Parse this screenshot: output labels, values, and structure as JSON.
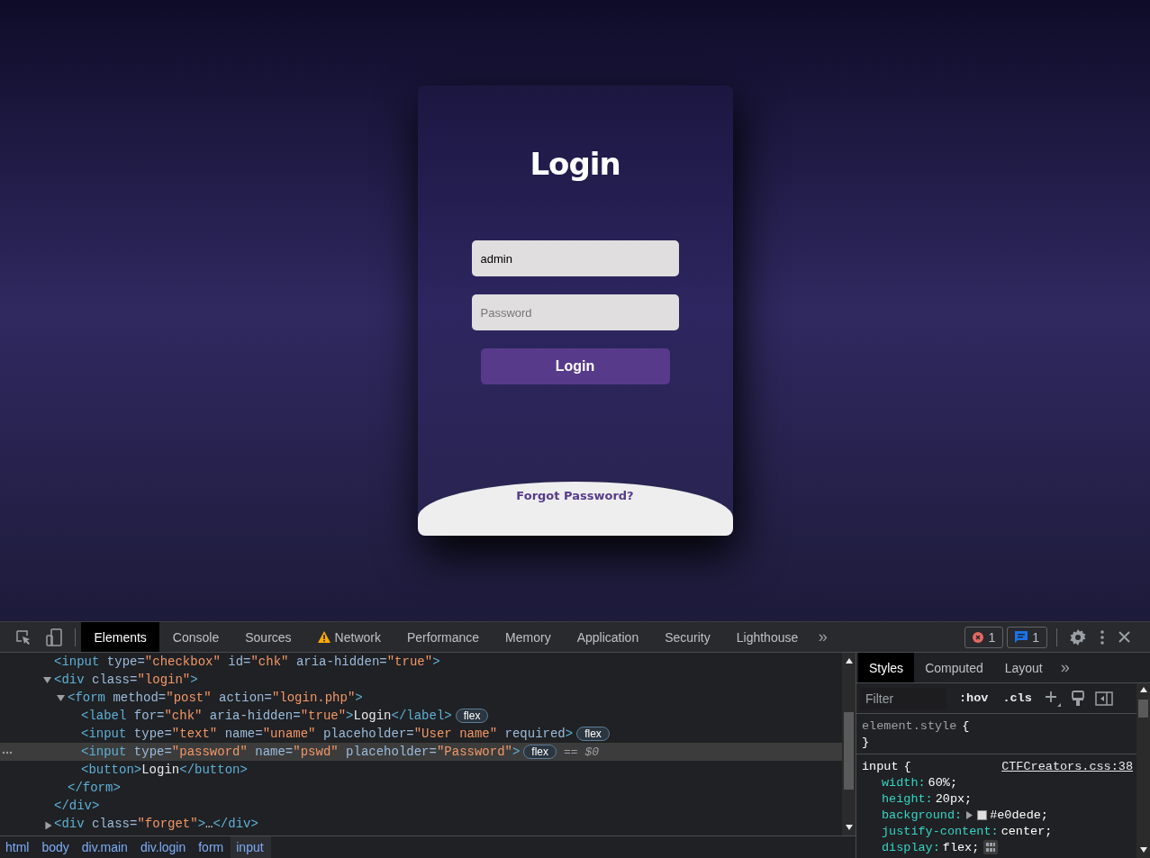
{
  "page": {
    "card": {
      "title": "Login",
      "username": {
        "value": "admin"
      },
      "password": {
        "placeholder": "Password"
      },
      "submit": "Login",
      "forgot_link": "Forgot Password?"
    }
  },
  "devtools": {
    "tabs": [
      {
        "label": "Elements",
        "selected": true,
        "warning": false
      },
      {
        "label": "Console",
        "selected": false,
        "warning": false
      },
      {
        "label": "Sources",
        "selected": false,
        "warning": false
      },
      {
        "label": "Network",
        "selected": false,
        "warning": true
      },
      {
        "label": "Performance",
        "selected": false,
        "warning": false
      },
      {
        "label": "Memory",
        "selected": false,
        "warning": false
      },
      {
        "label": "Application",
        "selected": false,
        "warning": false
      },
      {
        "label": "Security",
        "selected": false,
        "warning": false
      },
      {
        "label": "Lighthouse",
        "selected": false,
        "warning": false
      }
    ],
    "more_tabs": "»",
    "error_count": "1",
    "message_count": "1",
    "dom": [
      {
        "open": [
          {
            "kind": "tag",
            "t": "<input"
          },
          {
            "kind": "attr",
            "t": " type="
          },
          {
            "kind": "val",
            "t": "\"checkbox\""
          },
          {
            "kind": "attr",
            "t": " id="
          },
          {
            "kind": "val",
            "t": "\"chk\""
          },
          {
            "kind": "attr",
            "t": " aria-hidden="
          },
          {
            "kind": "val",
            "t": "\"true\""
          },
          {
            "kind": "tag",
            "t": ">"
          }
        ],
        "selected": false
      },
      {
        "open": [
          {
            "kind": "tag",
            "t": "<div"
          },
          {
            "kind": "attr",
            "t": " class="
          },
          {
            "kind": "val",
            "t": "\"login\""
          },
          {
            "kind": "tag",
            "t": ">"
          }
        ],
        "selected": false,
        "expanded": true,
        "close": "</div>",
        "children": [
          {
            "open": [
              {
                "kind": "tag",
                "t": "<form"
              },
              {
                "kind": "attr",
                "t": " method="
              },
              {
                "kind": "val",
                "t": "\"post\""
              },
              {
                "kind": "attr",
                "t": " action="
              },
              {
                "kind": "val",
                "t": "\"login.php\""
              },
              {
                "kind": "tag",
                "t": ">"
              }
            ],
            "selected": false,
            "expanded": true,
            "close": "</form>",
            "children": [
              {
                "open": [
                  {
                    "kind": "tag",
                    "t": "<label"
                  },
                  {
                    "kind": "attr",
                    "t": " for="
                  },
                  {
                    "kind": "val",
                    "t": "\"chk\""
                  },
                  {
                    "kind": "attr",
                    "t": " aria-hidden="
                  },
                  {
                    "kind": "val",
                    "t": "\"true\""
                  },
                  {
                    "kind": "tag",
                    "t": ">"
                  },
                  {
                    "kind": "text",
                    "t": "Login"
                  },
                  {
                    "kind": "tag",
                    "t": "</label>"
                  }
                ],
                "badge": "flex",
                "selected": false
              },
              {
                "open": [
                  {
                    "kind": "tag",
                    "t": "<input"
                  },
                  {
                    "kind": "attr",
                    "t": " type="
                  },
                  {
                    "kind": "val",
                    "t": "\"text\""
                  },
                  {
                    "kind": "attr",
                    "t": " name="
                  },
                  {
                    "kind": "val",
                    "t": "\"uname\""
                  },
                  {
                    "kind": "attr",
                    "t": " placeholder="
                  },
                  {
                    "kind": "val",
                    "t": "\"User name\""
                  },
                  {
                    "kind": "attr",
                    "t": " required"
                  },
                  {
                    "kind": "tag",
                    "t": ">"
                  }
                ],
                "badge": "flex",
                "selected": false
              },
              {
                "open": [
                  {
                    "kind": "tag",
                    "t": "<input"
                  },
                  {
                    "kind": "attr",
                    "t": " type="
                  },
                  {
                    "kind": "val",
                    "t": "\"password\""
                  },
                  {
                    "kind": "attr",
                    "t": " name="
                  },
                  {
                    "kind": "val",
                    "t": "\"pswd\""
                  },
                  {
                    "kind": "attr",
                    "t": " placeholder="
                  },
                  {
                    "kind": "val",
                    "t": "\"Password\""
                  },
                  {
                    "kind": "tag",
                    "t": ">"
                  }
                ],
                "badge": "flex",
                "selected": true,
                "ref": "== $0"
              },
              {
                "open": [
                  {
                    "kind": "tag",
                    "t": "<button>"
                  },
                  {
                    "kind": "text",
                    "t": "Login"
                  },
                  {
                    "kind": "tag",
                    "t": "</button>"
                  }
                ],
                "selected": false
              }
            ]
          }
        ]
      },
      {
        "open": [
          {
            "kind": "tag",
            "t": "<div"
          },
          {
            "kind": "attr",
            "t": " class="
          },
          {
            "kind": "val",
            "t": "\"forget\""
          },
          {
            "kind": "tag",
            "t": ">"
          },
          {
            "kind": "text",
            "t": "…"
          },
          {
            "kind": "tag",
            "t": "</div>"
          }
        ],
        "selected": false,
        "expanded": false
      }
    ],
    "breadcrumbs": [
      {
        "label": "html",
        "selected": false
      },
      {
        "label": "body",
        "selected": false
      },
      {
        "label": "div.main",
        "selected": false
      },
      {
        "label": "div.login",
        "selected": false
      },
      {
        "label": "form",
        "selected": false
      },
      {
        "label": "input",
        "selected": true
      }
    ],
    "side_tabs": [
      {
        "label": "Styles",
        "selected": true
      },
      {
        "label": "Computed",
        "selected": false
      },
      {
        "label": "Layout",
        "selected": false
      }
    ],
    "side_more": "»",
    "filter": {
      "placeholder": "Filter"
    },
    "hov": ":hov",
    "cls": ".cls",
    "rules": [
      {
        "selector": "element.style",
        "kind": "inline",
        "open_brace": "{",
        "close_brace": "}"
      },
      {
        "selector": "input",
        "kind": "sheet",
        "open_brace": "{",
        "source": "CTFCreators.css:38",
        "declarations": [
          {
            "prop": "width:",
            "value": "60%;",
            "kind": "plain"
          },
          {
            "prop": "height:",
            "value": "20px;",
            "kind": "plain"
          },
          {
            "prop": "background:",
            "value": "#e0dede;",
            "kind": "color",
            "color": "#e0dede"
          },
          {
            "prop": "justify-content:",
            "value": "center;",
            "kind": "plain"
          },
          {
            "prop": "display:",
            "value": "flex;",
            "kind": "flex"
          }
        ]
      }
    ]
  }
}
